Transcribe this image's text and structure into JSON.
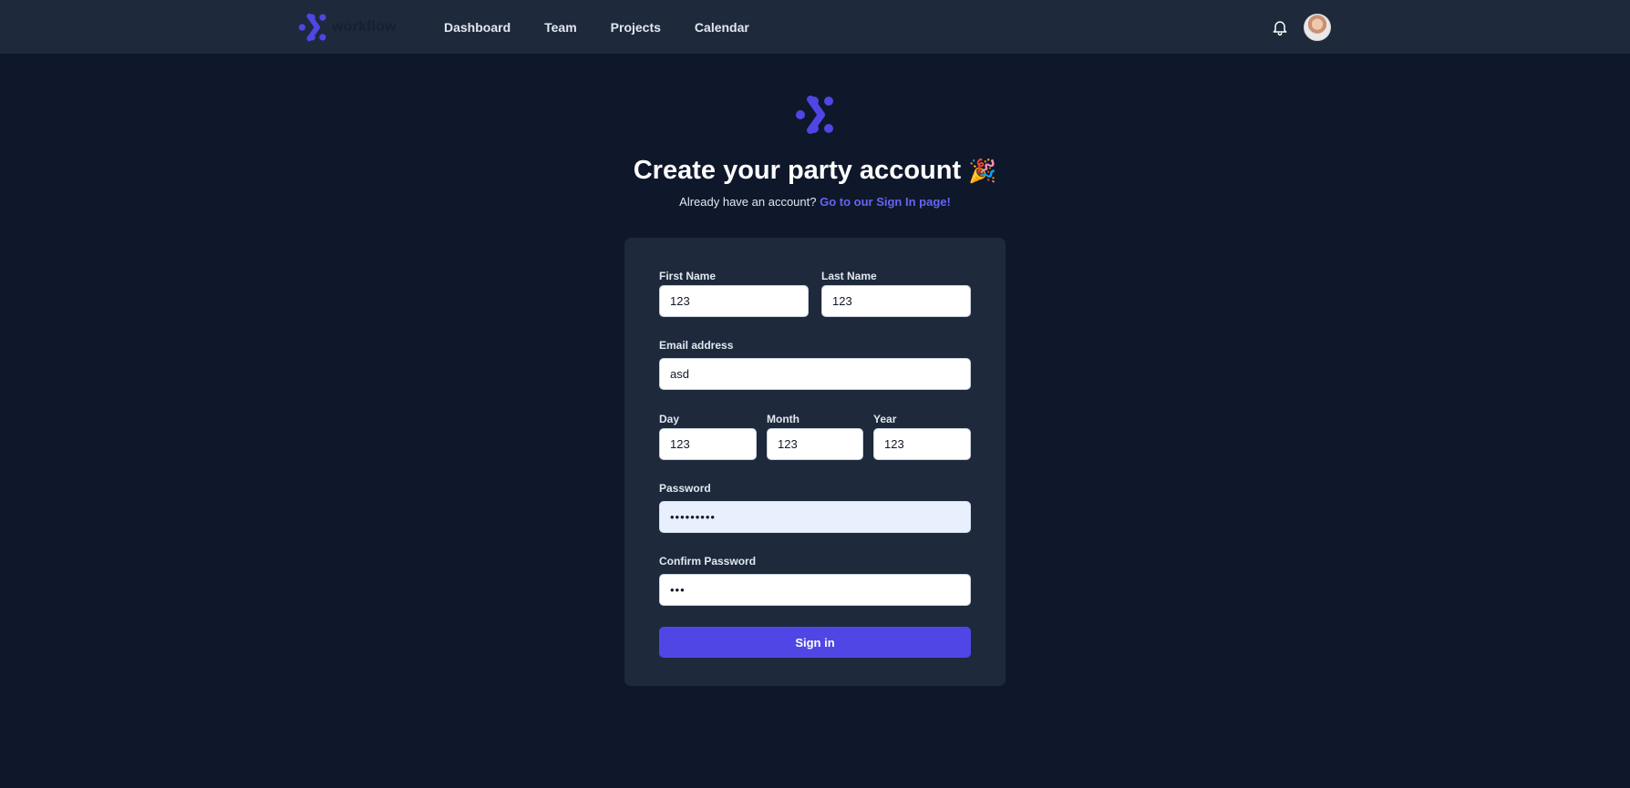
{
  "nav": {
    "brand_logo_icon": "workflow-logo-icon",
    "items": [
      {
        "label": "Dashboard"
      },
      {
        "label": "Team"
      },
      {
        "label": "Projects"
      },
      {
        "label": "Calendar"
      }
    ],
    "notification_icon": "bell-icon",
    "avatar": "user-avatar"
  },
  "header": {
    "logo_icon": "workflow-logo-icon",
    "title": "Create your party account",
    "title_emoji": "🎉",
    "subtitle_prefix": "Already have an account?",
    "signin_link": "Go to our Sign In page!"
  },
  "form": {
    "first_name": {
      "label": "First Name",
      "value": "123"
    },
    "last_name": {
      "label": "Last Name",
      "value": "123"
    },
    "email": {
      "label": "Email address",
      "value": "asd"
    },
    "day": {
      "label": "Day",
      "value": "123"
    },
    "month": {
      "label": "Month",
      "value": "123"
    },
    "year": {
      "label": "Year",
      "value": "123"
    },
    "password": {
      "label": "Password",
      "value": "•••••••••"
    },
    "confirm_password": {
      "label": "Confirm Password",
      "value": "•••"
    },
    "submit_label": "Sign in"
  },
  "colors": {
    "page_bg": "#0f172a",
    "panel_bg": "#1e293b",
    "accent": "#4f46e5",
    "link": "#6366f1"
  }
}
